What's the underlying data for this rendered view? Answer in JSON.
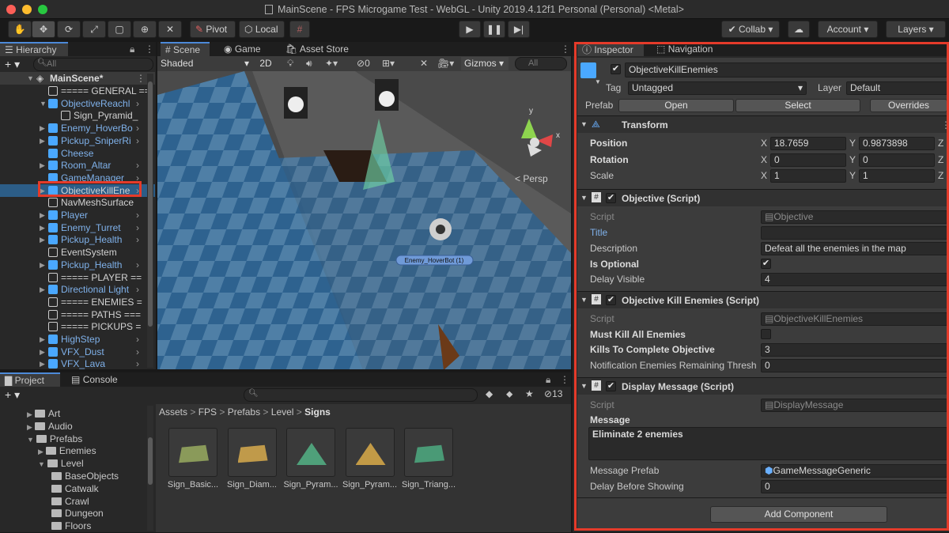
{
  "window": {
    "title": "MainScene - FPS Microgame Test - WebGL - Unity 2019.4.12f1 Personal (Personal) <Metal>"
  },
  "toolbar": {
    "pivot": "Pivot",
    "local": "Local",
    "collab": "Collab",
    "account": "Account",
    "layers": "Layers"
  },
  "hierarchy": {
    "tab": "Hierarchy",
    "search_placeholder": "All",
    "scene": "MainScene*",
    "items": [
      {
        "label": "===== GENERAL ==",
        "style": "white"
      },
      {
        "label": "ObjectiveReachl",
        "style": "blue"
      },
      {
        "label": "Sign_Pyramid_",
        "style": "white"
      },
      {
        "label": "Enemy_HoverBo",
        "style": "blue"
      },
      {
        "label": "Pickup_SniperRi",
        "style": "blue"
      },
      {
        "label": "Cheese",
        "style": "blue"
      },
      {
        "label": "Room_Altar",
        "style": "blue"
      },
      {
        "label": "GameManager",
        "style": "blue"
      },
      {
        "label": "ObjectiveKillEne",
        "style": "selected"
      },
      {
        "label": "NavMeshSurface",
        "style": "white"
      },
      {
        "label": "Player",
        "style": "blue"
      },
      {
        "label": "Enemy_Turret",
        "style": "blue"
      },
      {
        "label": "Pickup_Health",
        "style": "blue"
      },
      {
        "label": "EventSystem",
        "style": "white"
      },
      {
        "label": "Pickup_Health",
        "style": "blue"
      },
      {
        "label": "===== PLAYER ==",
        "style": "white"
      },
      {
        "label": "Directional Light",
        "style": "blue"
      },
      {
        "label": "===== ENEMIES =",
        "style": "white"
      },
      {
        "label": "===== PATHS ===",
        "style": "white"
      },
      {
        "label": "===== PICKUPS =",
        "style": "white"
      },
      {
        "label": "HighStep",
        "style": "blue"
      },
      {
        "label": "VFX_Dust",
        "style": "blue"
      },
      {
        "label": "VFX_Lava",
        "style": "blue"
      }
    ]
  },
  "scene": {
    "tabs": [
      "Scene",
      "Game",
      "Asset Store"
    ],
    "shading": "Shaded",
    "mode_2d": "2D",
    "hidden_count": "0",
    "gizmos": "Gizmos",
    "search_placeholder": "All",
    "persp": "< Persp",
    "enemy_label": "Enemy_HoverBot (1)",
    "axis_x": "x",
    "axis_y": "y",
    "axis_z": "z"
  },
  "project": {
    "tabs": [
      "Project",
      "Console"
    ],
    "breadcrumb": [
      "Assets",
      "FPS",
      "Prefabs",
      "Level",
      "Signs"
    ],
    "hidden_count": "13",
    "tree": [
      {
        "label": "Art",
        "indent": 1
      },
      {
        "label": "Audio",
        "indent": 1
      },
      {
        "label": "Prefabs",
        "indent": 1
      },
      {
        "label": "Enemies",
        "indent": 2
      },
      {
        "label": "Level",
        "indent": 2
      },
      {
        "label": "BaseObjects",
        "indent": 3
      },
      {
        "label": "Catwalk",
        "indent": 3
      },
      {
        "label": "Crawl",
        "indent": 3
      },
      {
        "label": "Dungeon",
        "indent": 3
      },
      {
        "label": "Floors",
        "indent": 3
      }
    ],
    "assets": [
      {
        "label": "Sign_Basic...",
        "color": "#8a9a5a"
      },
      {
        "label": "Sign_Diam...",
        "color": "#c09a4a"
      },
      {
        "label": "Sign_Pyram...",
        "color": "#4fa07a"
      },
      {
        "label": "Sign_Pyram...",
        "color": "#c29a46"
      },
      {
        "label": "Sign_Triang...",
        "color": "#4a9a76"
      }
    ]
  },
  "inspector": {
    "tabs": [
      "Inspector",
      "Navigation"
    ],
    "object_name": "ObjectiveKillEnemies",
    "tag_label": "Tag",
    "tag_value": "Untagged",
    "layer_label": "Layer",
    "layer_value": "Default",
    "prefab_label": "Prefab",
    "open": "Open",
    "select": "Select",
    "overrides": "Overrides",
    "transform": {
      "title": "Transform",
      "position_label": "Position",
      "rotation_label": "Rotation",
      "scale_label": "Scale",
      "x": "X",
      "y": "Y",
      "z": "Z",
      "pos_x": "18.7659",
      "pos_y": "0.9873898",
      "rot_x": "0",
      "rot_y": "0",
      "scale_x": "1",
      "scale_y": "1"
    },
    "objective": {
      "title": "Objective (Script)",
      "script_label": "Script",
      "script_value": "Objective",
      "title_label": "Title",
      "title_value": "",
      "description_label": "Description",
      "description_value": "Defeat all the enemies in the map",
      "optional_label": "Is Optional",
      "optional_checked": true,
      "delay_label": "Delay Visible",
      "delay_value": "4"
    },
    "kill": {
      "title": "Objective Kill Enemies (Script)",
      "script_label": "Script",
      "script_value": "ObjectiveKillEnemies",
      "must_kill_label": "Must Kill All Enemies",
      "must_kill_checked": false,
      "kills_label": "Kills To Complete Objective",
      "kills_value": "3",
      "notif_label": "Notification Enemies Remaining Thresh",
      "notif_value": "0"
    },
    "display": {
      "title": "Display Message (Script)",
      "script_label": "Script",
      "script_value": "DisplayMessage",
      "message_label": "Message",
      "message_value": "Eliminate 2 enemies",
      "prefab_label": "Message Prefab",
      "prefab_value": "GameMessageGeneric",
      "delay_label": "Delay Before Showing",
      "delay_value": "0"
    },
    "add_component": "Add Component"
  },
  "colors": {
    "accent": "#4d8ad8",
    "highlight": "#e53b2a",
    "selection": "#2c5d87"
  }
}
